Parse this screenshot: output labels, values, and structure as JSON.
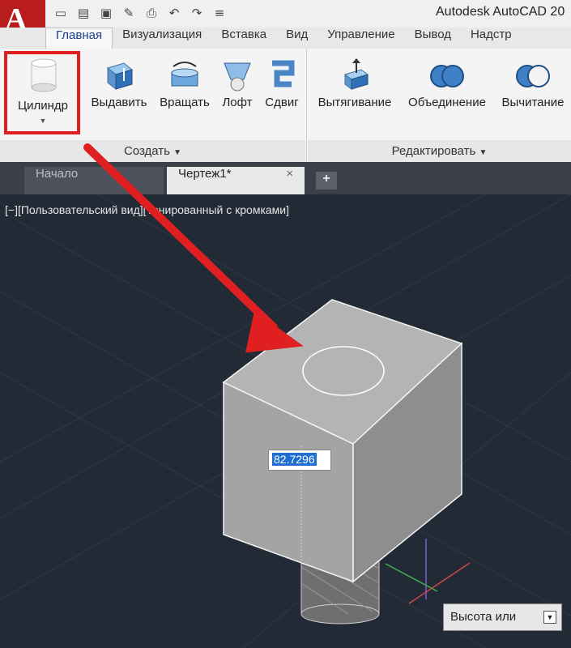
{
  "app_title": "Autodesk AutoCAD 20",
  "app_menu": {
    "letter": "A",
    "caret": "▾"
  },
  "quick_access": [
    "new-icon",
    "open-icon",
    "save-icon",
    "save-as-icon",
    "print-icon",
    "undo-icon",
    "redo-icon",
    "customize-icon"
  ],
  "ribbon_tabs": [
    "Главная",
    "Визуализация",
    "Вставка",
    "Вид",
    "Управление",
    "Вывод",
    "Надстр"
  ],
  "active_tab": "Главная",
  "ribbon": {
    "create_panel": {
      "title": "Создать",
      "buttons": [
        "Цилиндр",
        "Выдавить",
        "Вращать",
        "Лофт",
        "Сдвиг"
      ]
    },
    "edit_panel": {
      "title": "Редактировать",
      "buttons": [
        "Вытягивание",
        "Объединение",
        "Вычитание"
      ]
    }
  },
  "doc_tabs": [
    {
      "label": "Начало",
      "active": false
    },
    {
      "label": "Чертеж1*",
      "active": true
    }
  ],
  "doc_close": "×",
  "doc_new": "+",
  "viewport_label": "[−][Пользовательский вид][Тонированный с кромками]",
  "dynamic_input": "82.7296",
  "command_prompt": "Высота или",
  "colors": {
    "highlight": "#e02020",
    "viewport_bg": "#222a35",
    "selection": "#1e6fd0"
  }
}
